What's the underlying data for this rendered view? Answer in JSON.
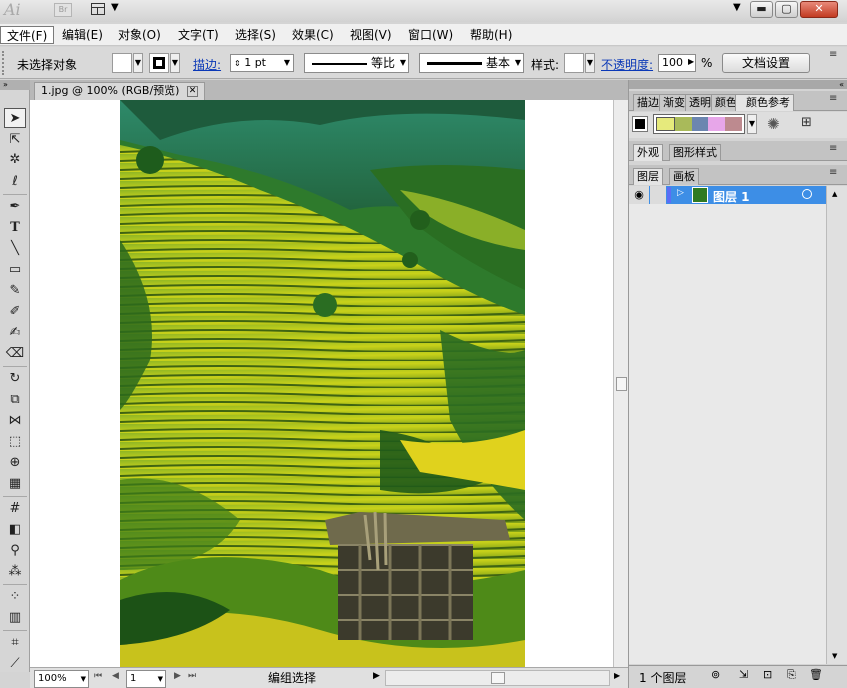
{
  "app": {
    "logo": "Ai",
    "bridge": "Br"
  },
  "window_buttons": [
    "▾",
    "▭",
    "▢",
    "✕"
  ],
  "menu": {
    "items": [
      "文件(F)",
      "编辑(E)",
      "对象(O)",
      "文字(T)",
      "选择(S)",
      "效果(C)",
      "视图(V)",
      "窗口(W)",
      "帮助(H)"
    ],
    "active_index": 0
  },
  "control": {
    "selection_status": "未选择对象",
    "stroke_link": "描边:",
    "stroke_weight": "1 pt",
    "profile_uniform": "等比",
    "brush_basic": "基本",
    "style_label": "样式:",
    "opacity_link": "不透明度:",
    "opacity_value": "100",
    "opacity_unit": "%",
    "doc_setup_button": "文档设置"
  },
  "document": {
    "tab_title": "1.jpg @ 100% (RGB/预览)",
    "close_glyph": "⊠"
  },
  "status": {
    "zoom": "100%",
    "artboard": "1",
    "mode": "编组选择"
  },
  "panels": {
    "top_tabs": [
      "描边",
      "渐变",
      "透明",
      "颜色",
      "颜色参考"
    ],
    "color_guide_swatches": [
      "#e6ea7c",
      "#a9ba5a",
      "#6c86b0",
      "#e7a6e9",
      "#bd8a8f"
    ],
    "appearance_tabs": [
      "外观",
      "图形样式"
    ],
    "layer_tabs": [
      "图层",
      "画板"
    ],
    "layer_name": "图层 1",
    "layer_count": "1 个图层"
  },
  "colors": {
    "accent": "#3d8ee6",
    "link": "#0a38b7"
  }
}
